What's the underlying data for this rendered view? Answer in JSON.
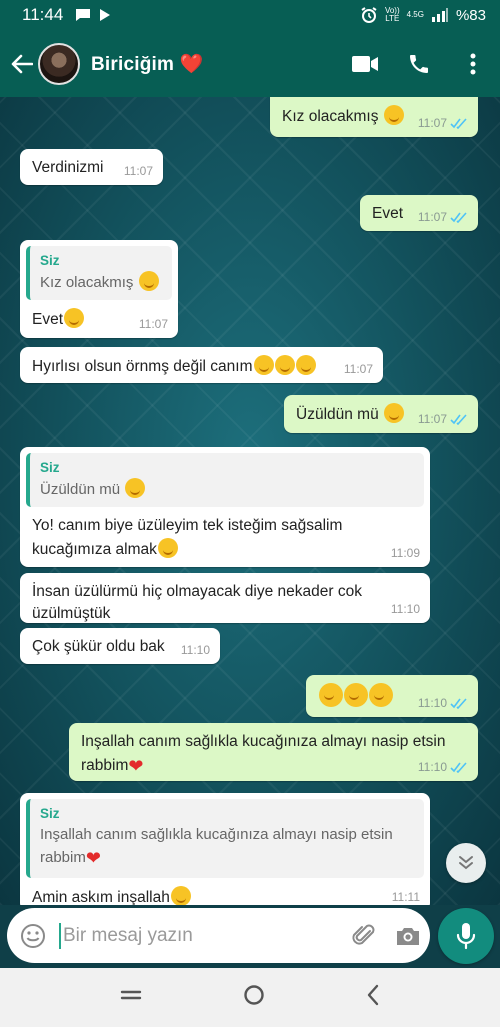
{
  "status_bar": {
    "time": "11:44",
    "volte": "Vo))",
    "lte": "LTE",
    "network": "4.5G",
    "battery": "%83"
  },
  "header": {
    "contact_name": "Biriciğim ❤️"
  },
  "messages": [
    {
      "dir": "out",
      "text": "Kız olacakmış",
      "time": "11:07"
    },
    {
      "dir": "in",
      "text": "Verdinizmi",
      "time": "11:07"
    },
    {
      "dir": "out",
      "text": "Evet",
      "time": "11:07"
    },
    {
      "dir": "in",
      "quote_author": "Siz",
      "quote_text": "Kız olacakmış",
      "text": "Evet",
      "time": "11:07"
    },
    {
      "dir": "in",
      "text": "Hyırlısı olsun örnmş değil canım",
      "time": "11:07"
    },
    {
      "dir": "out",
      "text": "Üzüldün mü",
      "time": "11:07"
    },
    {
      "dir": "in",
      "quote_author": "Siz",
      "quote_text": "Üzüldün mü",
      "text": "Yo! canım biye üzüleyim tek isteğim sağsalim kucağımıza almak",
      "time": "11:09"
    },
    {
      "dir": "in",
      "text": "İnsan üzülürmü hiç olmayacak diye nekader cok üzülmüştük",
      "time": "11:10"
    },
    {
      "dir": "in",
      "text": "Çok şükür oldu bak",
      "time": "11:10"
    },
    {
      "dir": "out",
      "text": "",
      "time": "11:10"
    },
    {
      "dir": "out",
      "text": "Inşallah canım sağlıkla kucağınıza almayı nasip etsin rabbim",
      "time": "11:10"
    },
    {
      "dir": "in",
      "quote_author": "Siz",
      "quote_text": "Inşallah canım sağlıkla kucağınıza almayı nasip etsin rabbim",
      "text": "Amin askım inşallah",
      "time": "11:11"
    }
  ],
  "input": {
    "placeholder": "Bir mesaj yazın"
  },
  "colors": {
    "header": "#075e54",
    "outgoing_bubble": "#dcf8c6",
    "incoming_bubble": "#ffffff",
    "accent": "#25a88d",
    "read_ticks": "#4fc3f7"
  }
}
